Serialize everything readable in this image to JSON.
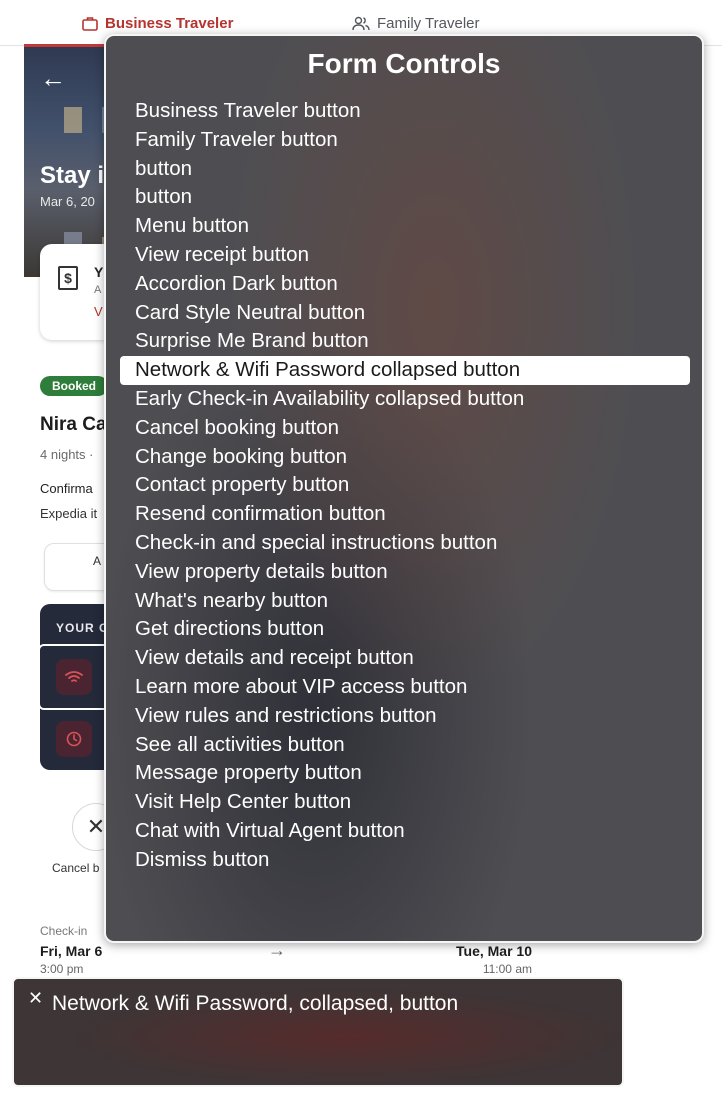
{
  "tabs": [
    {
      "label": "Business Traveler",
      "selected": true
    },
    {
      "label": "Family Traveler",
      "selected": false
    }
  ],
  "hero": {
    "back_icon": "arrow-left-icon",
    "title": "Stay i",
    "dates": "Mar 6, 20"
  },
  "receipt_card": {
    "icon": "receipt-icon",
    "title": "Y",
    "subtitle": "A",
    "link": "V"
  },
  "booking": {
    "badge": "Booked",
    "hotel_name": "Nira Ca",
    "nights": "4 nights ·",
    "confirmation": "Confirma",
    "expedia": "Expedia it",
    "action_pill": "A"
  },
  "dark_card": {
    "title": "YOUR C",
    "icons": [
      "wifi-icon",
      "clock-icon"
    ]
  },
  "cancel": {
    "icon": "close-icon",
    "label": "Cancel b"
  },
  "stay_dates": {
    "checkin_label": "Check-in",
    "checkin_date": "Fri, Mar 6",
    "checkin_time": "3:00 pm",
    "checkout_date": "Tue, Mar 10",
    "checkout_time": "11:00 am"
  },
  "rotor": {
    "title": "Form Controls",
    "items": [
      "Business Traveler button",
      "Family Traveler button",
      "button",
      "button",
      "Menu button",
      "View receipt button",
      "Accordion Dark button",
      "Card Style Neutral button",
      "Surprise Me Brand button",
      "Network & Wifi Password collapsed button",
      "Early Check-in Availability collapsed button",
      "Cancel booking button",
      "Change booking button",
      "Contact property button",
      "Resend confirmation button",
      "Check-in and special instructions button",
      "View property details button",
      "What's nearby button",
      "Get directions button",
      "View details and receipt button",
      "Learn more about VIP access button",
      "View rules and restrictions button",
      "See all activities button",
      "Message property button",
      "Visit Help Center button",
      "Chat with Virtual Agent button",
      "Dismiss button"
    ],
    "selected_index": 9
  },
  "caption": {
    "text": "Network & Wifi Password, collapsed, button"
  }
}
